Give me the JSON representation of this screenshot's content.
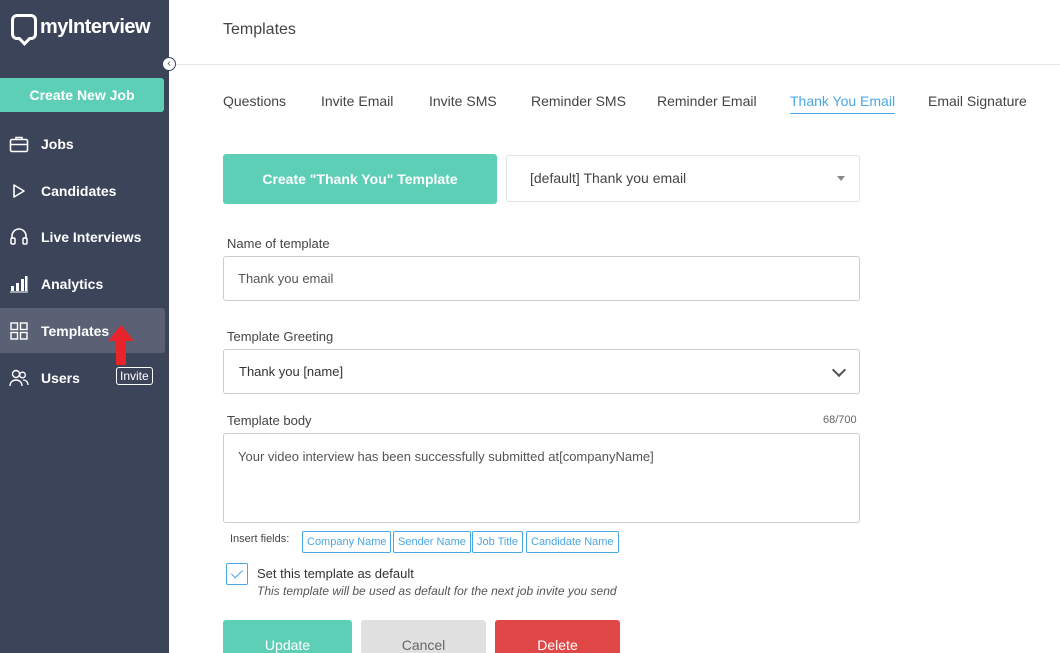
{
  "app": {
    "name": "myInterview"
  },
  "sidebar": {
    "create_job_label": "Create New Job",
    "items": [
      {
        "label": "Jobs",
        "icon": "briefcase-icon"
      },
      {
        "label": "Candidates",
        "icon": "play-icon"
      },
      {
        "label": "Live Interviews",
        "icon": "headset-icon"
      },
      {
        "label": "Analytics",
        "icon": "bar-chart-icon"
      },
      {
        "label": "Templates",
        "icon": "grid-icon",
        "active": true
      },
      {
        "label": "Users",
        "icon": "users-icon"
      }
    ],
    "invite_badge": "Invite",
    "collapse_glyph": "‹"
  },
  "header": {
    "title": "Templates"
  },
  "tabs": [
    {
      "label": "Questions"
    },
    {
      "label": "Invite Email"
    },
    {
      "label": "Invite SMS"
    },
    {
      "label": "Reminder SMS"
    },
    {
      "label": "Reminder Email"
    },
    {
      "label": "Thank You Email",
      "active": true
    },
    {
      "label": "Email Signature"
    }
  ],
  "form": {
    "create_template_label": "Create \"Thank You\" Template",
    "template_select_value": "[default] Thank you email",
    "name_label": "Name of template",
    "name_value": "Thank you email",
    "greeting_label": "Template Greeting",
    "greeting_value": "Thank you [name]",
    "body_label": "Template body",
    "body_counter": "68/700",
    "body_value": "Your video interview has been successfully submitted at[companyName]",
    "insert_fields_label": "Insert fields:",
    "insert_fields": [
      "Company Name",
      "Sender Name",
      "Job Title",
      "Candidate Name"
    ],
    "default_checked": true,
    "default_label": "Set this template as default",
    "default_hint": "This template will be used as default for the next job invite you send"
  },
  "actions": {
    "update_label": "Update",
    "cancel_label": "Cancel",
    "delete_label": "Delete"
  },
  "colors": {
    "sidebar_bg": "#3c4459",
    "accent_green": "#5ecfb7",
    "accent_blue": "#4aa8e0",
    "delete_red": "#e04848",
    "annotation_arrow": "#e8232a"
  }
}
